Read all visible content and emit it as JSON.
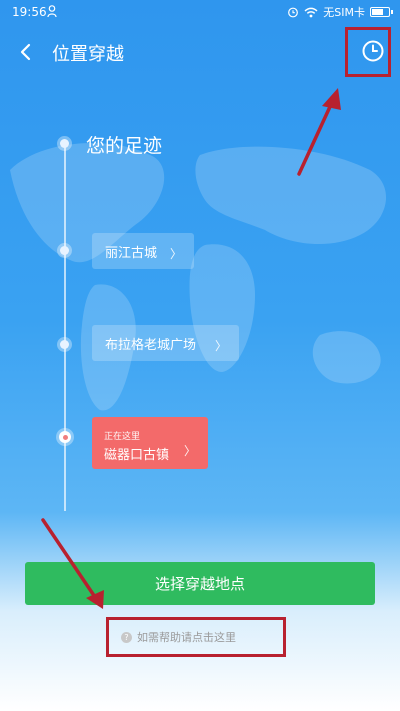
{
  "status_bar": {
    "time": "19:56",
    "carrier": "无SIM卡"
  },
  "header": {
    "title": "位置穿越"
  },
  "timeline": {
    "heading": "您的足迹",
    "places": [
      {
        "name": "丽江古城"
      },
      {
        "name": "布拉格老城广场"
      }
    ],
    "current": {
      "label": "正在这里",
      "name": "磁器口古镇"
    }
  },
  "actions": {
    "choose_location": "选择穿越地点",
    "help_text": "如需帮助请点击这里"
  },
  "colors": {
    "accent_blue": "#2f96ee",
    "cta_green": "#2fbb5f",
    "current_red": "#f36a6a",
    "annotation_red": "#b8212f"
  },
  "icons": [
    "person-icon",
    "alarm-icon",
    "wifi-icon",
    "battery-icon",
    "back-icon",
    "history-clock-icon",
    "chevron-right-icon",
    "help-icon"
  ]
}
